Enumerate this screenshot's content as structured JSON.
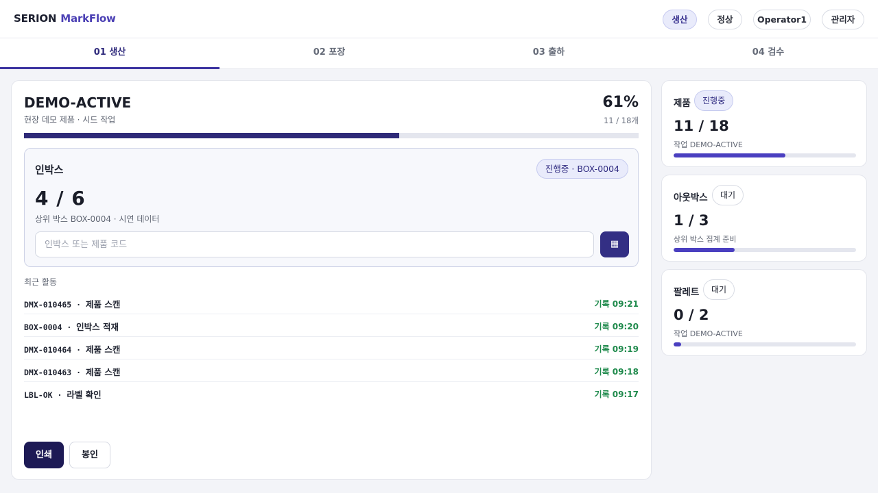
{
  "header": {
    "brand_main": "SERION",
    "brand_accent": "MarkFlow",
    "pills": [
      {
        "label": "생산",
        "active": true
      },
      {
        "label": "정상",
        "active": false
      },
      {
        "label": "Operator1",
        "active": false
      },
      {
        "label": "관리자",
        "active": false
      }
    ]
  },
  "tabs": [
    {
      "label": "01 생산",
      "active": true
    },
    {
      "label": "02 포장",
      "active": false
    },
    {
      "label": "03 출하",
      "active": false
    },
    {
      "label": "04 검수",
      "active": false
    }
  ],
  "job": {
    "title": "DEMO-ACTIVE",
    "subtitle": "현장 데모 제품 · 시드 작업",
    "percent_label": "61%",
    "count_label": "11 / 18개",
    "progress": 0.61
  },
  "inbox": {
    "title": "인박스",
    "badge": "진행중 · BOX-0004",
    "count": "4 / 6",
    "subtitle": "상위 박스 BOX-0004 · 시연 데이터",
    "input_placeholder": "인박스 또는 제품 코드",
    "input_value": "",
    "scan_icon": "▦"
  },
  "recent": {
    "label": "최근 활동",
    "items": [
      {
        "code": "DMX-010465",
        "sep": " · ",
        "action": "제품 스캔",
        "time": "기록 09:21"
      },
      {
        "code": "BOX-0004",
        "sep": " · ",
        "action": "인박스 적재",
        "time": "기록 09:20"
      },
      {
        "code": "DMX-010464",
        "sep": " · ",
        "action": "제품 스캔",
        "time": "기록 09:19"
      },
      {
        "code": "DMX-010463",
        "sep": " · ",
        "action": "제품 스캔",
        "time": "기록 09:18"
      },
      {
        "code": "LBL-OK",
        "sep": " · ",
        "action": "라벨 확인",
        "time": "기록 09:17"
      }
    ]
  },
  "actions": {
    "print_label": "인쇄",
    "seal_label": "봉인"
  },
  "side_cards": [
    {
      "title": "제품",
      "badge": "진행중",
      "badge_active": true,
      "count": "11 / 18",
      "subtitle": "작업 DEMO-ACTIVE",
      "progress": 0.611
    },
    {
      "title": "아웃박스",
      "badge": "대기",
      "badge_active": false,
      "count": "1 / 3",
      "subtitle": "상위 박스 집계 준비",
      "progress": 0.333
    },
    {
      "title": "팔레트",
      "badge": "대기",
      "badge_active": false,
      "count": "0 / 2",
      "subtitle": "작업 DEMO-ACTIVE",
      "progress": 0.04
    }
  ],
  "colors": {
    "accent": "#3b33a0",
    "primary_dark": "#1d1a55",
    "time_green": "#1f8a4c",
    "progress_fill": "#4a3fc0"
  }
}
